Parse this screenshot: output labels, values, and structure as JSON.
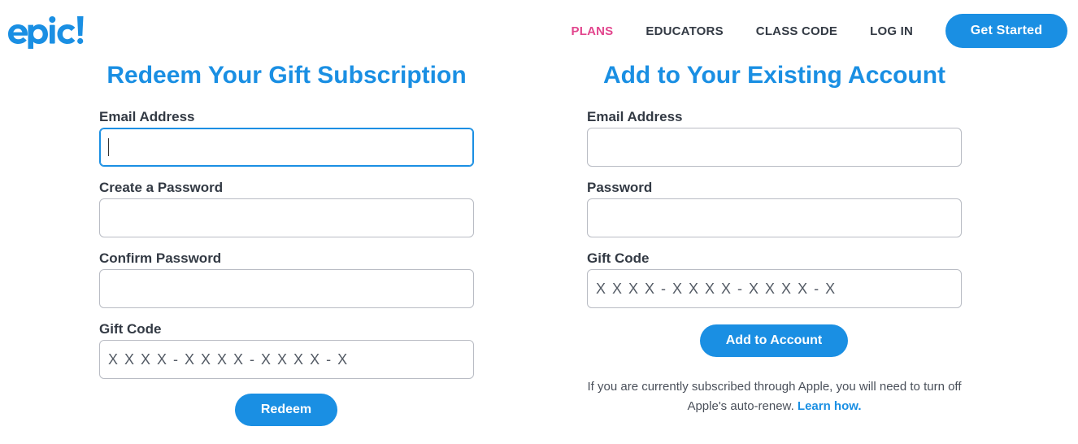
{
  "brand": {
    "logo_text": "epic!",
    "accent": "#1a8fe3",
    "highlight": "#e2458d"
  },
  "nav": {
    "items": [
      {
        "label": "PLANS",
        "active": true
      },
      {
        "label": "EDUCATORS",
        "active": false
      },
      {
        "label": "CLASS CODE",
        "active": false
      },
      {
        "label": "LOG IN",
        "active": false
      }
    ],
    "cta_label": "Get Started"
  },
  "redeem": {
    "title": "Redeem Your Gift Subscription",
    "email_label": "Email Address",
    "email_value": "",
    "password_label": "Create a Password",
    "confirm_label": "Confirm Password",
    "gift_label": "Gift Code",
    "gift_placeholder": "X X X X - X X X X - X X X X - X",
    "button_label": "Redeem"
  },
  "existing": {
    "title": "Add to Your Existing Account",
    "email_label": "Email Address",
    "password_label": "Password",
    "gift_label": "Gift Code",
    "gift_placeholder": "X X X X - X X X X - X X X X - X",
    "button_label": "Add to Account",
    "note_text": "If you are currently subscribed through Apple, you will need to turn off Apple's auto-renew.",
    "note_link": "Learn how."
  }
}
